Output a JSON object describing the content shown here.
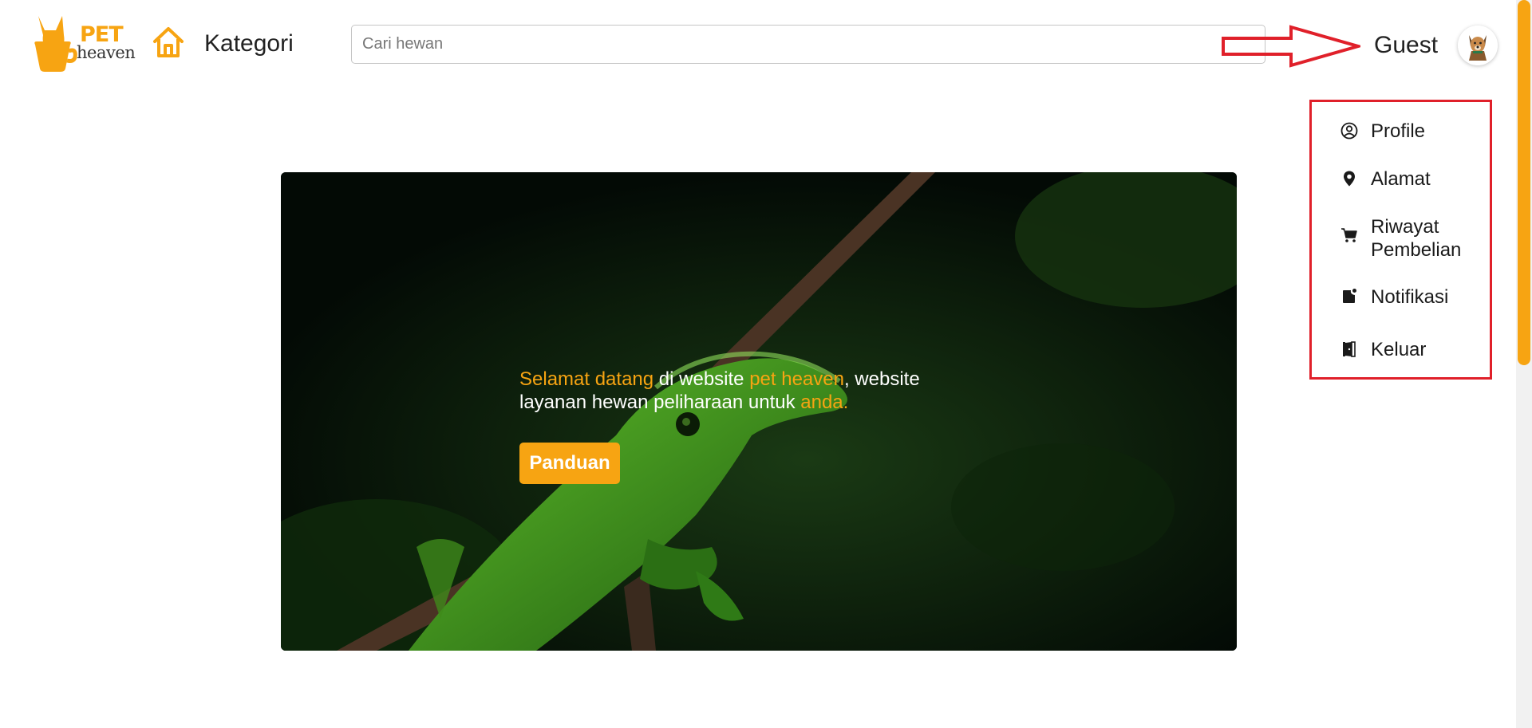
{
  "brand": {
    "logo_top": "PET",
    "logo_bottom": "heaven",
    "accent_color": "#f7a412"
  },
  "header": {
    "home_icon": "home-icon",
    "kategori_label": "Kategori",
    "search_placeholder": "Cari hewan",
    "search_value": "",
    "user_label": "Guest",
    "avatar_icon": "dog-avatar"
  },
  "menu": {
    "highlight_color": "#e0202a",
    "items": [
      {
        "label": "Profile",
        "icon": "user-circle-icon"
      },
      {
        "label": "Alamat",
        "icon": "location-pin-icon"
      },
      {
        "label": "Riwayat Pembelian",
        "icon": "cart-icon"
      },
      {
        "label": "Notifikasi",
        "icon": "notification-icon"
      },
      {
        "label": "Keluar",
        "icon": "exit-door-icon"
      }
    ]
  },
  "hero": {
    "text_parts": [
      "Selamat datang",
      " di website ",
      "pet heaven",
      ", website layanan hewan peliharaan untuk ",
      "anda."
    ],
    "button_label": "Panduan",
    "image_subject": "green lizard on branch"
  }
}
